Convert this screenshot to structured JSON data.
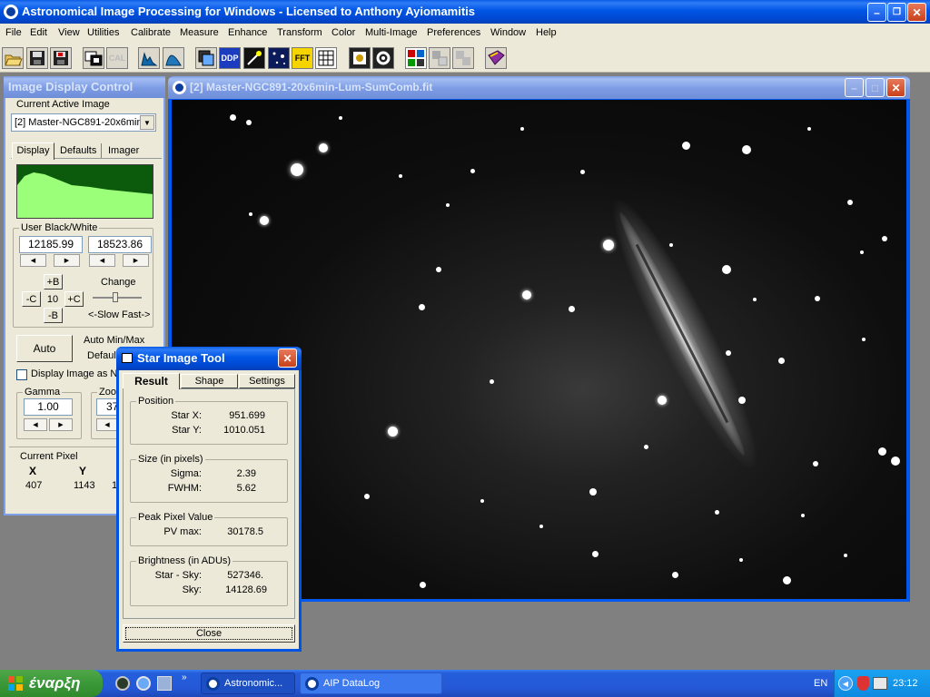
{
  "app": {
    "title": "Astronomical Image Processing for Windows - Licensed to Anthony Ayiomamitis",
    "title_color": "#0054e3"
  },
  "menu": [
    "File",
    "Edit",
    "View",
    "Utilities",
    "Calibrate",
    "Measure",
    "Enhance",
    "Transform",
    "Color",
    "Multi-Image",
    "Preferences",
    "Window",
    "Help"
  ],
  "toolbar_icons": [
    "open-folder-icon",
    "save-icon",
    "save-as-fits-icon",
    "image-icon",
    "cal-icon",
    "histogram-icon",
    "curve-icon",
    "stack-icon",
    "ddp-icon",
    "wand-icon",
    "star-field-icon",
    "fft-icon",
    "grid-icon",
    "star-tool-icon",
    "gear-icon",
    "multi-image-icon",
    "align-icon",
    "blink-icon",
    "datalog-book-icon"
  ],
  "toolbar_texts": {
    "cal": "CAL",
    "ddp": "DDP",
    "fft": "FFT"
  },
  "image_window": {
    "title": "[2] Master-NGC891-20x6min-Lum-SumComb.fit"
  },
  "display_control": {
    "title": "Image Display Control",
    "active_image_label": "Current Active Image",
    "active_image_value": "[2] Master-NGC891-20x6min-",
    "tabs": [
      "Display",
      "Defaults",
      "Imager"
    ],
    "black_white_label": "User Black/White",
    "black_value": "12185.99",
    "white_value": "18523.86",
    "brightness_up": "+B",
    "contrast_down": "-C",
    "step": "10",
    "contrast_up": "+C",
    "brightness_down": "-B",
    "change_label": "Change",
    "slow_fast_label": "<-Slow Fast->",
    "auto_label": "Auto",
    "auto_minmax_label": "Auto Min/Max",
    "default_label": "Default",
    "display_as_label": "Display Image as N",
    "gamma_label": "Gamma",
    "gamma_value": "1.00",
    "zoom_label": "Zoom",
    "zoom_value": "37",
    "current_pixel_label": "Current  Pixel",
    "x_header": "X",
    "y_header": "Y",
    "x_value": "407",
    "y_value": "1143",
    "extra_value": "1"
  },
  "star_tool": {
    "title": "Star Image Tool",
    "tabs": [
      "Result",
      "Shape",
      "Settings"
    ],
    "position_label": "Position",
    "star_x_label": "Star X:",
    "star_x_value": "951.699",
    "star_y_label": "Star Y:",
    "star_y_value": "1010.051",
    "size_label": "Size (in pixels)",
    "sigma_label": "Sigma:",
    "sigma_value": "2.39",
    "fwhm_label": "FWHM:",
    "fwhm_value": "5.62",
    "peak_label": "Peak Pixel Value",
    "pv_label": "PV max:",
    "pv_value": "30178.5",
    "brightness_label": "Brightness (in ADUs)",
    "star_sky_label": "Star - Sky:",
    "star_sky_value": "527346.",
    "sky_label": "Sky:",
    "sky_value": "14128.69",
    "close_label": "Close"
  },
  "taskbar": {
    "start_label": "έναρξη",
    "quicklaunch_icons": [
      "media-player-icon",
      "browser-icon",
      "network-icon"
    ],
    "tasks": [
      "Astronomic...",
      "AIP DataLog"
    ],
    "language": "EN",
    "clock": "23:12"
  }
}
